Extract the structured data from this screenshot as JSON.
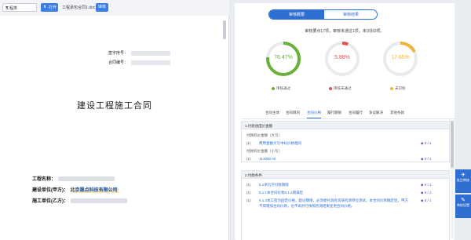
{
  "toolbar": {
    "select_value": "工程类",
    "open_label": "打开",
    "file_name": "工程承包合同1.doc",
    "view_label": "审核"
  },
  "document": {
    "archive_no_label": "签字序号：",
    "contract_no_label": "合同编号：",
    "title": "建设工程施工合同",
    "project_name_label": "工程名称：",
    "employer_label": "建设单位(甲方)：",
    "employer_value": "北京慧点科技有限公司",
    "contractor_label": "施工单位(乙方)："
  },
  "panel": {
    "tab_active": "审核概要",
    "tab_other": "审核结果",
    "summary_prefix": "审核要点17项，审核未通过1项，未识别3项。",
    "summary_pass": "审核通过",
    "gauges": [
      {
        "value": "76.47%",
        "color": "#6ab139",
        "fraction": 0.7647,
        "legend": "审核通过"
      },
      {
        "value": "5.88%",
        "color": "#e05252",
        "fraction": 0.0588,
        "legend": "审核未通过"
      },
      {
        "value": "17.65%",
        "color": "#f0b43b",
        "fraction": 0.1765,
        "legend": "未识别"
      }
    ],
    "tabs": [
      "合同主体",
      "合同目的",
      "合同价格",
      "履行期限",
      "合同履行",
      "争议解决",
      "其他条款"
    ],
    "active_tab_index": 2,
    "sections": [
      {
        "header": "1.付款进度价金额",
        "rows": [
          {
            "num": "",
            "text": "付款的价金额（大写）",
            "kind": "muted",
            "count": ""
          },
          {
            "num": "(1)",
            "text": "费用金额大写中标价格相同",
            "kind": "link",
            "count": "0 / 1"
          },
          {
            "num": "",
            "text": "付款的价金额（小写）",
            "kind": "muted",
            "count": ""
          },
          {
            "num": "(1)",
            "text": "314000.00",
            "kind": "link",
            "count": "0 / 1"
          }
        ]
      },
      {
        "header": "2.付款条件",
        "rows": [
          {
            "num": "(1)",
            "text": "6.1承包方付款期限",
            "kind": "link",
            "count": "0 / 1"
          },
          {
            "num": "(1)",
            "text": "6.1.1本合同价款6.1.2期满后",
            "kind": "link",
            "count": "0 / 1"
          },
          {
            "num": "(1)",
            "text": "6.1.3本工程为固定价格，超过期限，必须委托具有资质检测单位测试，本合同价款确定后，甲方不得增加合同价款，也不再另行按照检测结果变更合同价格。",
            "kind": "link",
            "count": "0 / 1"
          }
        ]
      }
    ]
  },
  "side_buttons": [
    {
      "icon": "✈",
      "label": "批注审核"
    },
    {
      "icon": "✎",
      "label": "审核设置"
    }
  ]
}
